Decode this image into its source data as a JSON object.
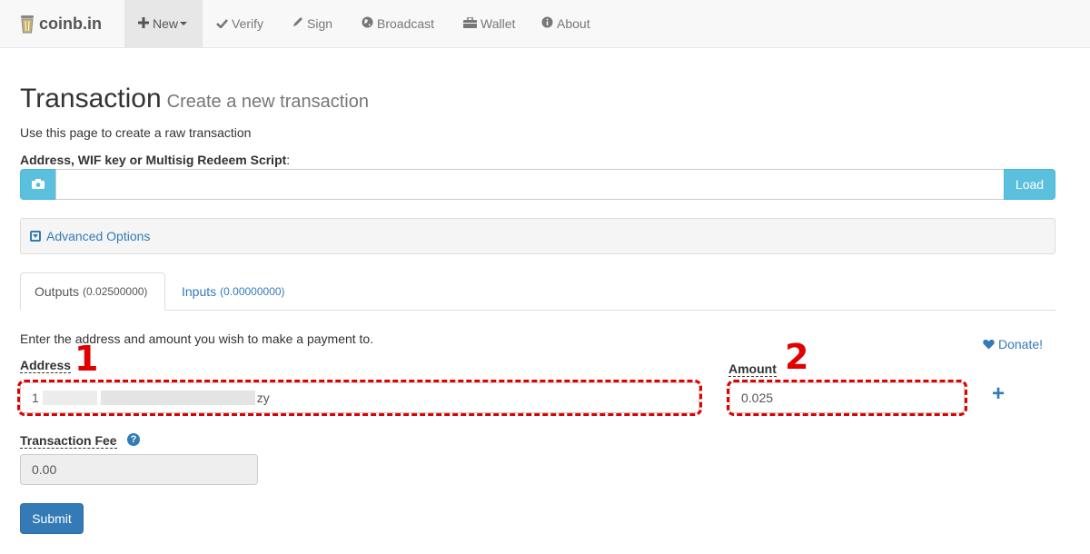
{
  "navbar": {
    "brand": "coinb.in",
    "items": [
      {
        "icon": "plus-icon",
        "label": "New"
      },
      {
        "icon": "check-icon",
        "label": "Verify"
      },
      {
        "icon": "pencil-icon",
        "label": "Sign"
      },
      {
        "icon": "globe-icon",
        "label": "Broadcast"
      },
      {
        "icon": "briefcase-icon",
        "label": "Wallet"
      },
      {
        "icon": "info-icon",
        "label": "About"
      }
    ]
  },
  "page": {
    "title": "Transaction",
    "subtitle": "Create a new transaction",
    "intro": "Use this page to create a raw transaction"
  },
  "address_loader": {
    "label": "Address, WIF key or Multisig Redeem Script",
    "label_suffix": ":",
    "value": "",
    "load_button": "Load"
  },
  "advanced_options": {
    "label": "Advanced Options"
  },
  "tabs": [
    {
      "label": "Outputs",
      "value": "(0.02500000)",
      "active": true
    },
    {
      "label": "Inputs",
      "value": "(0.00000000)",
      "active": false
    }
  ],
  "outputs": {
    "instruction": "Enter the address and amount you wish to make a payment to.",
    "donate": "Donate!",
    "address_label": "Address",
    "address_prefix": "1",
    "address_suffix": "zy",
    "amount_label": "Amount",
    "amount_value": "0.025",
    "add_symbol": "+"
  },
  "annotations": {
    "marker_1": "1",
    "marker_2": "2",
    "color": "#e00000"
  },
  "fee": {
    "label": "Transaction Fee",
    "help": "?",
    "value": "0.00"
  },
  "submit_label": "Submit",
  "colors": {
    "primary": "#337ab7",
    "info": "#5bc0de",
    "annotation": "#e00000"
  }
}
